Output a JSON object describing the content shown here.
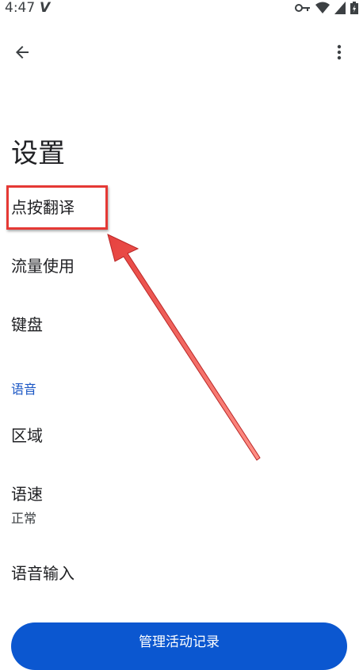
{
  "status_bar": {
    "time": "4:47",
    "carrier_icon": "V"
  },
  "app_bar": {
    "back_icon": "arrow-back",
    "more_icon": "more-vert"
  },
  "page_title": "设置",
  "items": {
    "tap_to_translate": "点按翻译",
    "data_usage": "流量使用",
    "keyboard": "键盘"
  },
  "speech_section": {
    "header": "语音",
    "region": "区域",
    "speed": "语速",
    "speed_value": "正常",
    "voice_input": "语音输入"
  },
  "manage_button_label": "管理活动记录",
  "annotation_color": "#e53935",
  "accent_color": "#0b57d0"
}
